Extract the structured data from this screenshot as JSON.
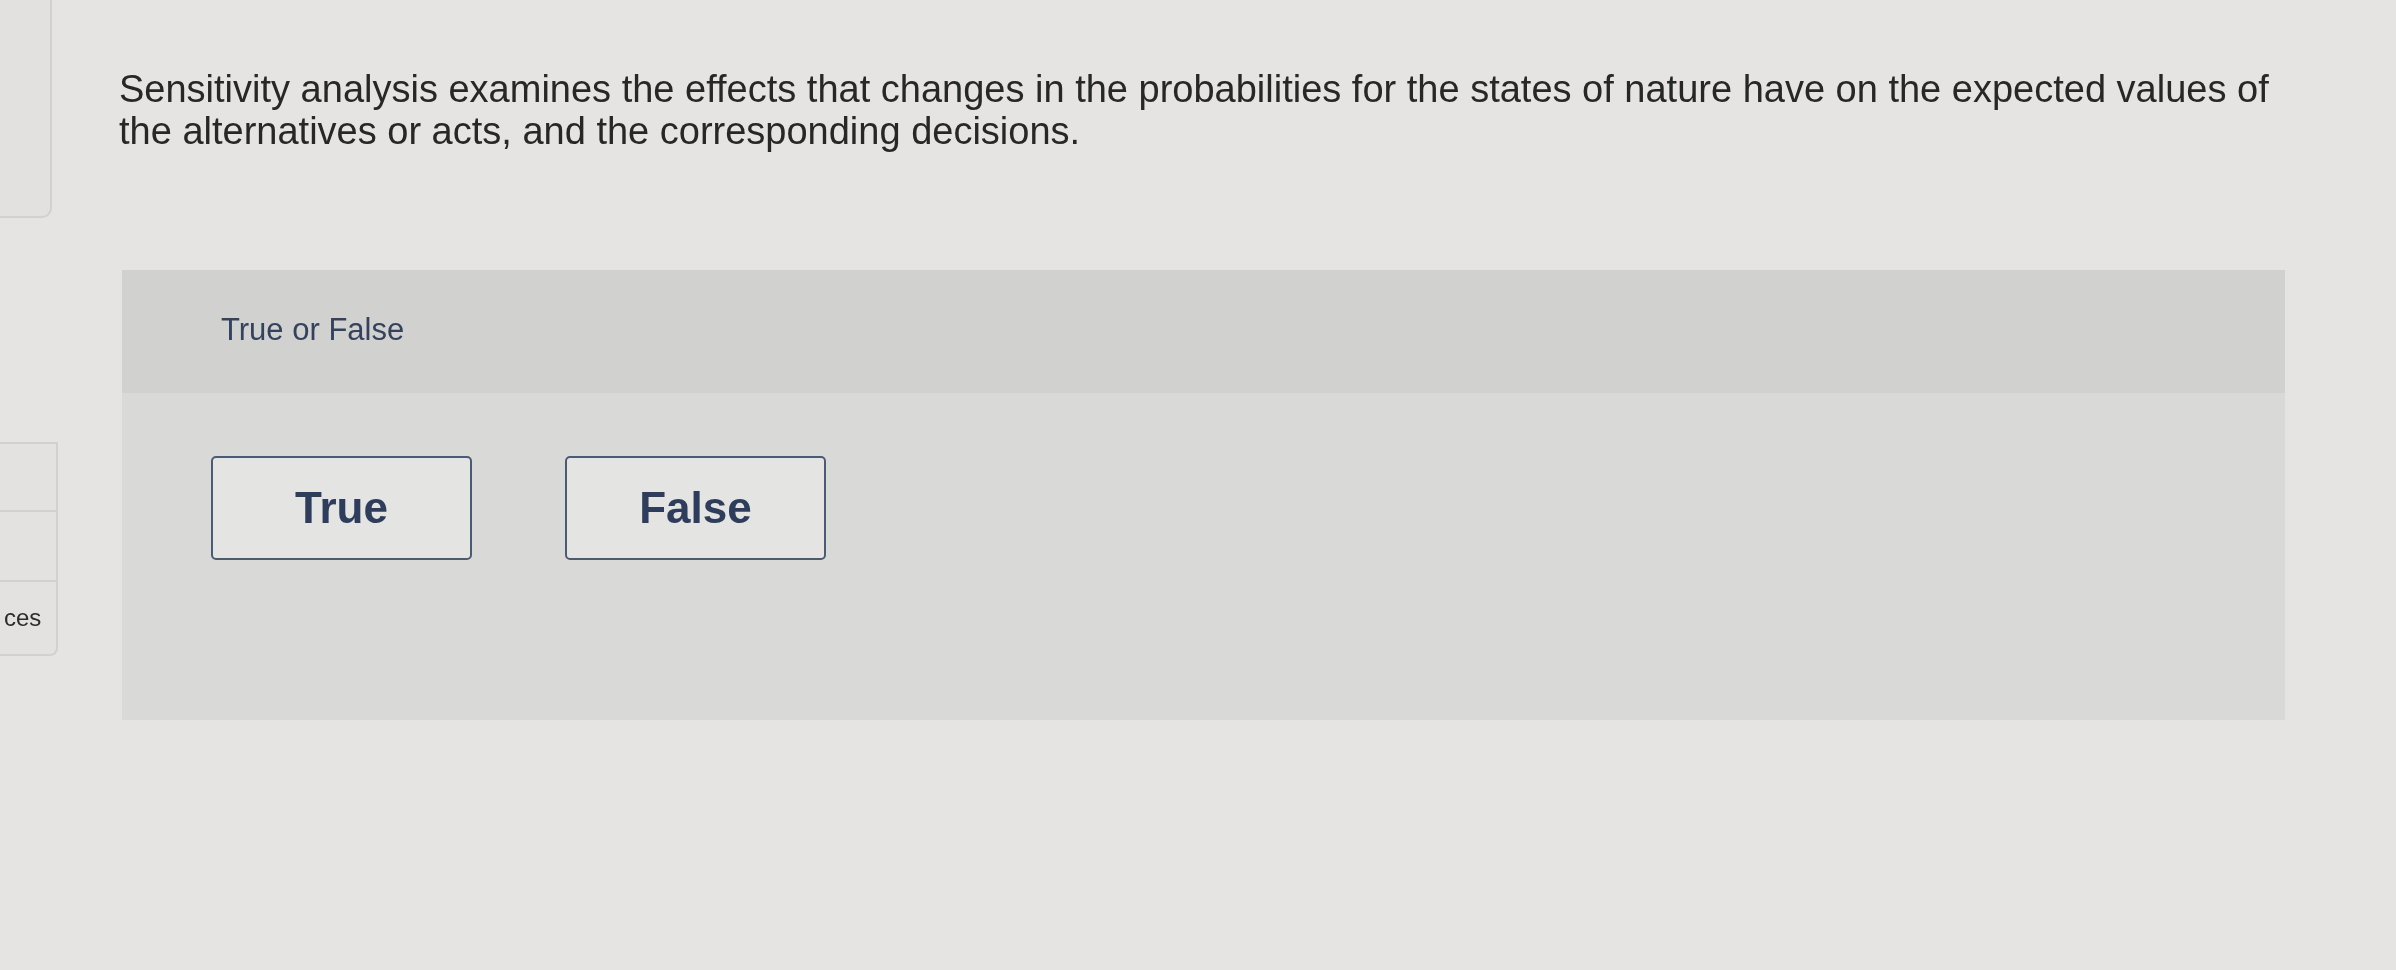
{
  "side_list": {
    "visible_text": "ces"
  },
  "question": {
    "text": "Sensitivity analysis examines the effects that changes in the probabilities for the states of nature have on the expected values of the alternatives or acts, and the corresponding decisions."
  },
  "answer_panel": {
    "prompt": "True or False",
    "options": [
      {
        "label": "True",
        "selected": false
      },
      {
        "label": "False",
        "selected": false
      }
    ]
  }
}
